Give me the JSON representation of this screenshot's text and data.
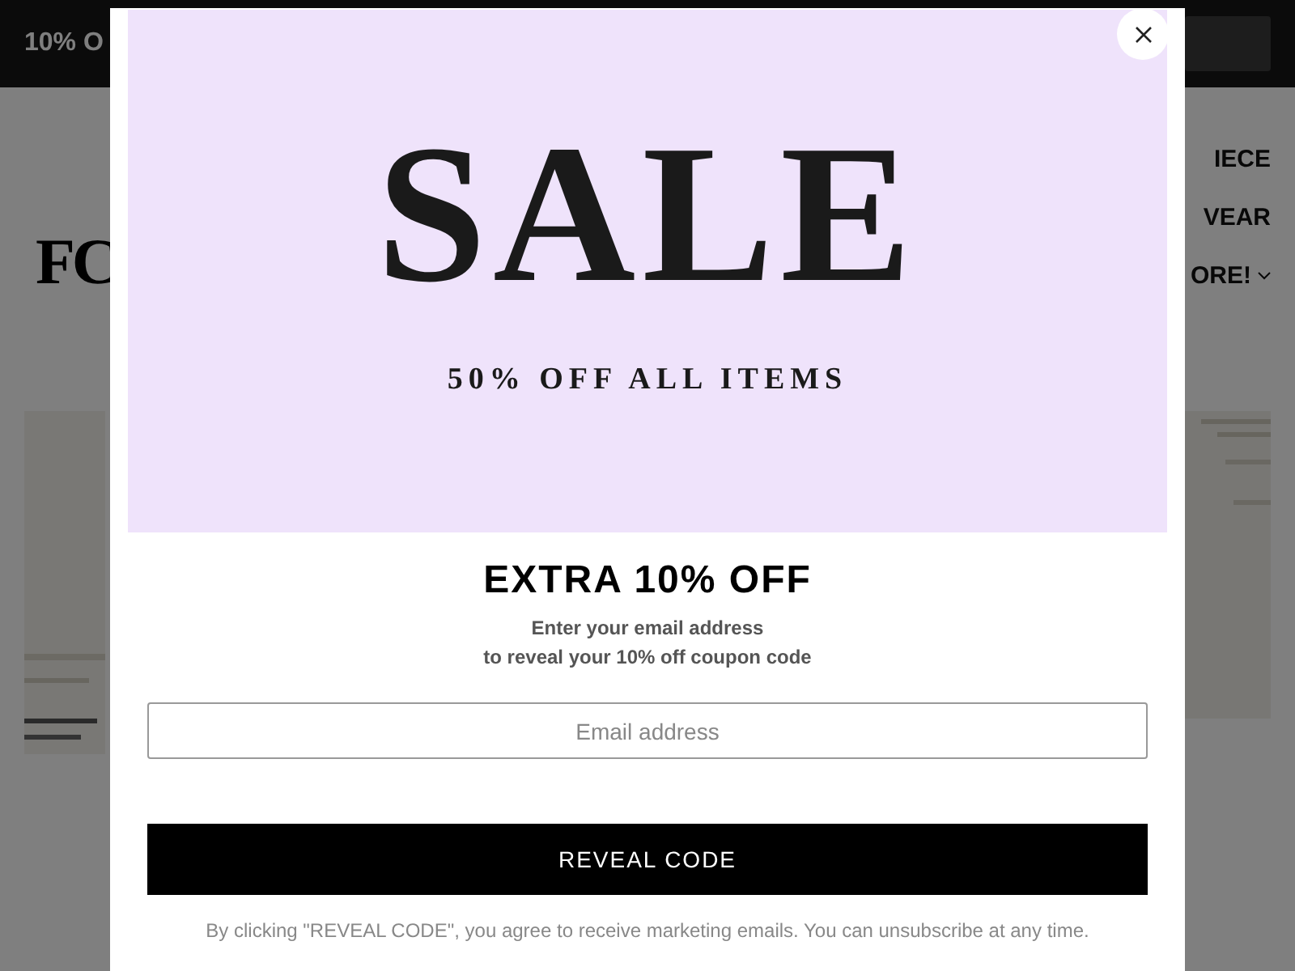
{
  "announcement": {
    "text": "10% O"
  },
  "logo": {
    "text": "FC"
  },
  "nav": [
    {
      "label": "IECE",
      "has_caret": false
    },
    {
      "label": "VEAR",
      "has_caret": false
    },
    {
      "label": "ORE!",
      "has_caret": true
    }
  ],
  "popup": {
    "banner": {
      "title": "SALE",
      "subtitle": "50% OFF ALL ITEMS"
    },
    "heading": "EXTRA 10% OFF",
    "lines": [
      "Enter your email address",
      "to reveal your 10% off coupon code"
    ],
    "email": {
      "placeholder": "Email address"
    },
    "button": "REVEAL CODE",
    "disclaimer": "By clicking \"REVEAL CODE\", you agree to receive marketing emails. You can unsubscribe at any time."
  }
}
